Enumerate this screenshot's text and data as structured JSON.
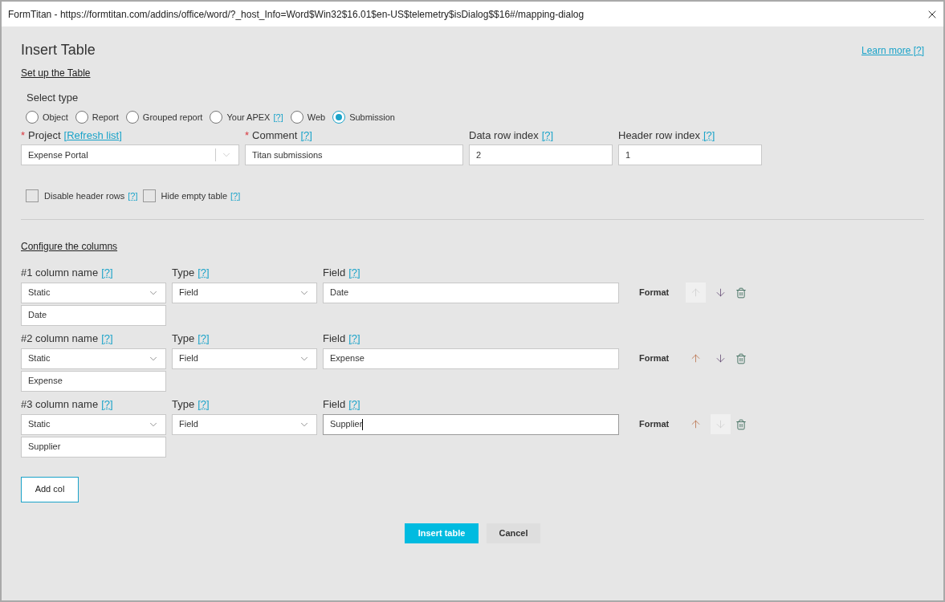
{
  "window": {
    "title": "FormTitan - https://formtitan.com/addins/office/word/?_host_Info=Word$Win32$16.01$en-US$telemetry$isDialog$$16#/mapping-dialog"
  },
  "heading": "Insert Table",
  "learn_more": "Learn more [?]",
  "setup_link": "Set up the Table",
  "select_type": {
    "label": "Select type",
    "options": [
      {
        "label": "Object",
        "selected": false
      },
      {
        "label": "Report",
        "selected": false
      },
      {
        "label": "Grouped report",
        "selected": false
      },
      {
        "label": "Your APEX",
        "help": "[?]",
        "selected": false
      },
      {
        "label": "Web",
        "selected": false
      },
      {
        "label": "Submission",
        "selected": true
      }
    ]
  },
  "fields": [
    {
      "kind": "select",
      "required": "*",
      "label": "Project",
      "link": "[Refresh list]",
      "value": "Expense Portal"
    },
    {
      "kind": "text",
      "required": "*",
      "label": "Comment",
      "help": "[?]",
      "value": "Titan submissions"
    },
    {
      "kind": "text",
      "label": "Data row index",
      "help": "[?]",
      "value": "2"
    },
    {
      "kind": "text",
      "label": "Header row index",
      "help": "[?]",
      "value": "1"
    }
  ],
  "checkboxes": [
    {
      "label": "Disable header rows",
      "help": "[?]",
      "checked": false
    },
    {
      "label": "Hide empty table",
      "help": "[?]",
      "checked": false
    }
  ],
  "columns_link": "Configure the columns",
  "columns": [
    {
      "label": "#1 column name",
      "help": "[?]",
      "source": "Static",
      "name": "Date",
      "type_label": "Type",
      "type_help": "[?]",
      "type": "Field",
      "field_label": "Field",
      "field_help": "[?]",
      "field": "Date",
      "focused": false,
      "format": "Format",
      "up_disabled": true,
      "down_disabled": false
    },
    {
      "label": "#2 column name",
      "help": "[?]",
      "source": "Static",
      "name": "Expense",
      "type_label": "Type",
      "type_help": "[?]",
      "type": "Field",
      "field_label": "Field",
      "field_help": "[?]",
      "field": "Expense",
      "focused": false,
      "format": "Format",
      "up_disabled": false,
      "down_disabled": false
    },
    {
      "label": "#3 column name",
      "help": "[?]",
      "source": "Static",
      "name": "Supplier",
      "type_label": "Type",
      "type_help": "[?]",
      "type": "Field",
      "field_label": "Field",
      "field_help": "[?]",
      "field": "Supplier",
      "focused": true,
      "format": "Format",
      "up_disabled": false,
      "down_disabled": true
    }
  ],
  "add_button": "Add col",
  "insert_button": "Insert table",
  "cancel_button": "Cancel"
}
